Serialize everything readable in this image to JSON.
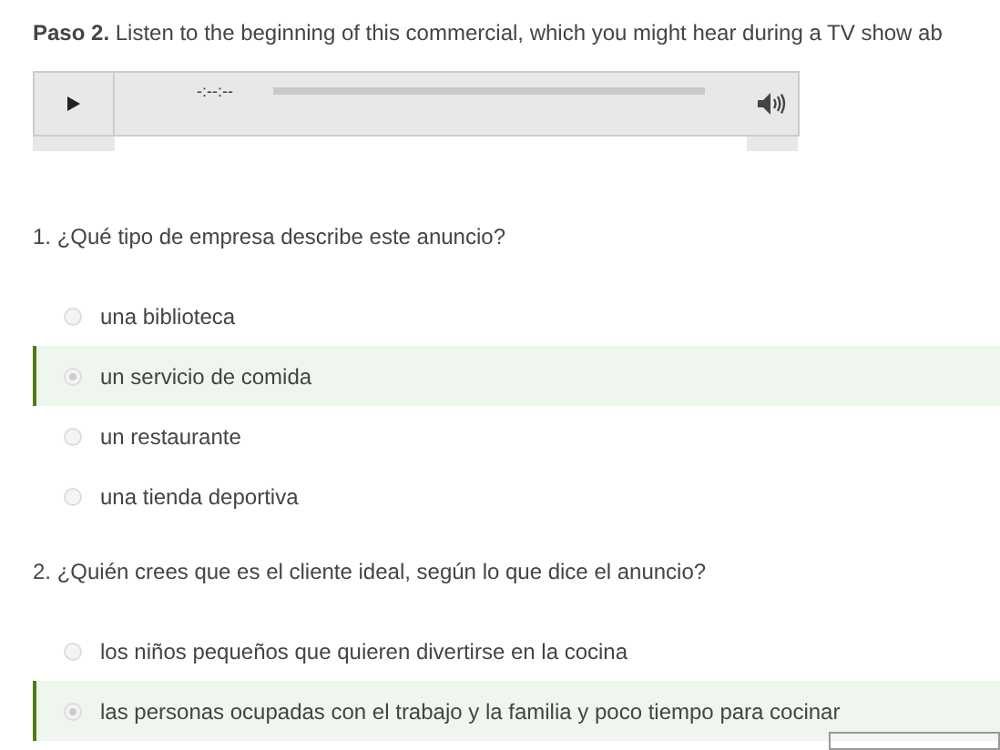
{
  "intro": "**Paso 2.** Listen to the beginning of this commercial, which you might hear during a TV show ab",
  "audio_player": {
    "time": "-:--:--"
  },
  "questions": [
    {
      "prompt": "1. ¿Qué tipo de empresa describe este anuncio?",
      "options": [
        {
          "label": "una biblioteca",
          "selected": false
        },
        {
          "label": "un servicio de comida",
          "selected": true
        },
        {
          "label": "un restaurante",
          "selected": false
        },
        {
          "label": "una tienda deportiva",
          "selected": false
        }
      ]
    },
    {
      "prompt": "2. ¿Quién crees que es el cliente ideal, según lo que dice el anuncio?",
      "options": [
        {
          "label": "los niños pequeños que quieren divertirse en la cocina",
          "selected": false
        },
        {
          "label": "las personas ocupadas con el trabajo y la familia y poco tiempo para cocinar",
          "selected": true
        }
      ]
    }
  ]
}
